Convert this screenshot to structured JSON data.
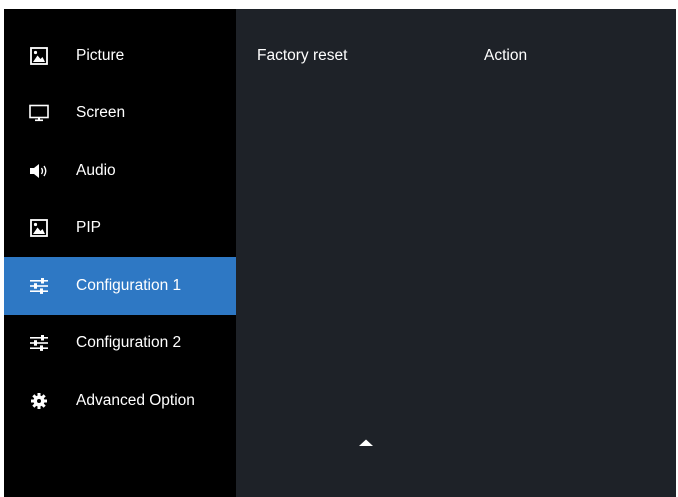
{
  "menu": {
    "items": [
      {
        "label": "Picture",
        "icon": "picture-icon",
        "selected": false
      },
      {
        "label": "Screen",
        "icon": "monitor-icon",
        "selected": false
      },
      {
        "label": "Audio",
        "icon": "speaker-icon",
        "selected": false
      },
      {
        "label": "PIP",
        "icon": "picture-icon",
        "selected": false
      },
      {
        "label": "Configuration 1",
        "icon": "sliders-icon",
        "selected": true
      },
      {
        "label": "Configuration 2",
        "icon": "sliders-icon",
        "selected": false
      },
      {
        "label": "Advanced Option",
        "icon": "gear-icon",
        "selected": false
      }
    ]
  },
  "content": {
    "rows": [
      {
        "label": "Factory reset",
        "value": "Action"
      }
    ],
    "scroll_indicator": "up-arrow-icon"
  },
  "colors": {
    "sidebar_bg": "#000000",
    "content_bg": "#1e2228",
    "selected_bg": "#2e78c4",
    "text": "#ffffff"
  }
}
